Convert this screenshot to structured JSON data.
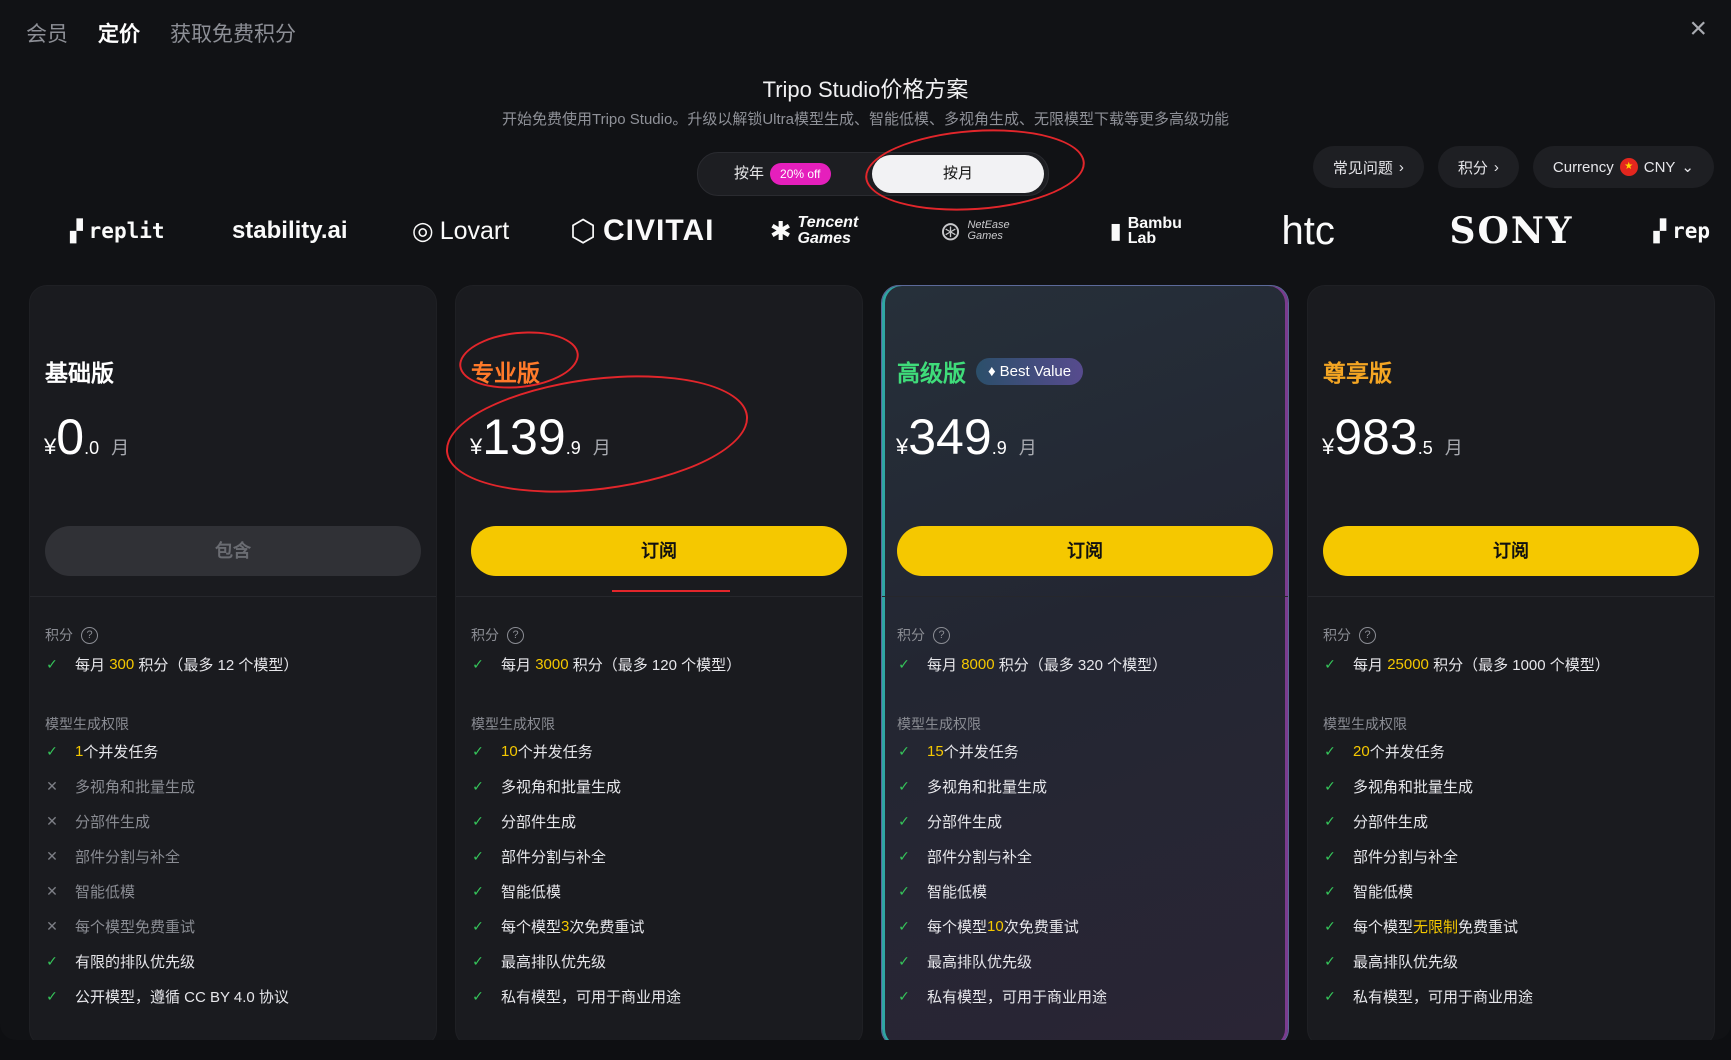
{
  "tabs": [
    "会员",
    "定价",
    "获取免费积分"
  ],
  "close_icon": "×",
  "title": "Tripo Studio价格方案",
  "subtitle": "开始免费使用Tripo Studio。升级以解锁Ultra模型生成、智能低模、多视角生成、无限模型下载等更多高级功能",
  "billing": {
    "yearly": "按年",
    "yearly_badge": "20% off",
    "monthly": "按月"
  },
  "pills": {
    "faq": "常见问题",
    "credits": "积分",
    "currency_label": "Currency",
    "currency_value": "CNY"
  },
  "logos": [
    "replit",
    "stability.ai",
    "Lovart",
    "CIVITAI",
    "Tencent Games",
    "NetEase Games",
    "Bambu Lab",
    "htc",
    "SONY",
    "rep"
  ],
  "plans": [
    {
      "name": "基础版",
      "color": "#ffffff",
      "currency": "¥",
      "price_int": "0",
      "price_dec": ".0",
      "per": "月",
      "button": "包含",
      "credits_label": "积分",
      "credits": {
        "pre": "每月",
        "num": "300",
        "post": "积分（最多 12 个模型）"
      },
      "perm_label": "模型生成权限",
      "features": [
        {
          "ok": true,
          "hl": "1",
          "text": " 个并发任务"
        },
        {
          "ok": false,
          "text": "多视角和批量生成"
        },
        {
          "ok": false,
          "text": "分部件生成"
        },
        {
          "ok": false,
          "text": "部件分割与补全"
        },
        {
          "ok": false,
          "text": "智能低模"
        },
        {
          "ok": false,
          "text": "每个模型免费重试"
        },
        {
          "ok": true,
          "text": "有限的排队优先级"
        },
        {
          "ok": true,
          "text": "公开模型，遵循 CC BY 4.0 协议"
        }
      ]
    },
    {
      "name": "专业版",
      "color": "#ff7a2a",
      "currency": "¥",
      "price_int": "139",
      "price_dec": ".9",
      "per": "月",
      "button": "订阅",
      "credits_label": "积分",
      "credits": {
        "pre": "每月",
        "num": "3000",
        "post": "积分（最多 120 个模型）"
      },
      "perm_label": "模型生成权限",
      "features": [
        {
          "ok": true,
          "hl": "10",
          "text": " 个并发任务"
        },
        {
          "ok": true,
          "text": "多视角和批量生成"
        },
        {
          "ok": true,
          "text": "分部件生成"
        },
        {
          "ok": true,
          "text": "部件分割与补全"
        },
        {
          "ok": true,
          "text": "智能低模"
        },
        {
          "ok": true,
          "pre": "每个模型 ",
          "hl": "3",
          "text": " 次免费重试"
        },
        {
          "ok": true,
          "text": "最高排队优先级"
        },
        {
          "ok": true,
          "text": "私有模型，可用于商业用途"
        }
      ]
    },
    {
      "name": "高级版",
      "color": "#3fdc7a",
      "badge": "Best Value",
      "currency": "¥",
      "price_int": "349",
      "price_dec": ".9",
      "per": "月",
      "button": "订阅",
      "credits_label": "积分",
      "credits": {
        "pre": "每月",
        "num": "8000",
        "post": "积分（最多 320 个模型）"
      },
      "perm_label": "模型生成权限",
      "features": [
        {
          "ok": true,
          "hl": "15",
          "text": " 个并发任务"
        },
        {
          "ok": true,
          "text": "多视角和批量生成"
        },
        {
          "ok": true,
          "text": "分部件生成"
        },
        {
          "ok": true,
          "text": "部件分割与补全"
        },
        {
          "ok": true,
          "text": "智能低模"
        },
        {
          "ok": true,
          "pre": "每个模型 ",
          "hl": "10",
          "text": " 次免费重试"
        },
        {
          "ok": true,
          "text": "最高排队优先级"
        },
        {
          "ok": true,
          "text": "私有模型，可用于商业用途"
        }
      ]
    },
    {
      "name": "尊享版",
      "color": "#f5a623",
      "currency": "¥",
      "price_int": "983",
      "price_dec": ".5",
      "per": "月",
      "button": "订阅",
      "credits_label": "积分",
      "credits": {
        "pre": "每月",
        "num": "25000",
        "post": "积分（最多 1000 个模型）"
      },
      "perm_label": "模型生成权限",
      "features": [
        {
          "ok": true,
          "hl": "20",
          "text": " 个并发任务"
        },
        {
          "ok": true,
          "text": "多视角和批量生成"
        },
        {
          "ok": true,
          "text": "分部件生成"
        },
        {
          "ok": true,
          "text": "部件分割与补全"
        },
        {
          "ok": true,
          "text": "智能低模"
        },
        {
          "ok": true,
          "pre": "每个模型 ",
          "hl": "无限制",
          "text": " 免费重试"
        },
        {
          "ok": true,
          "text": "最高排队优先级"
        },
        {
          "ok": true,
          "text": "私有模型，可用于商业用途"
        }
      ]
    }
  ]
}
